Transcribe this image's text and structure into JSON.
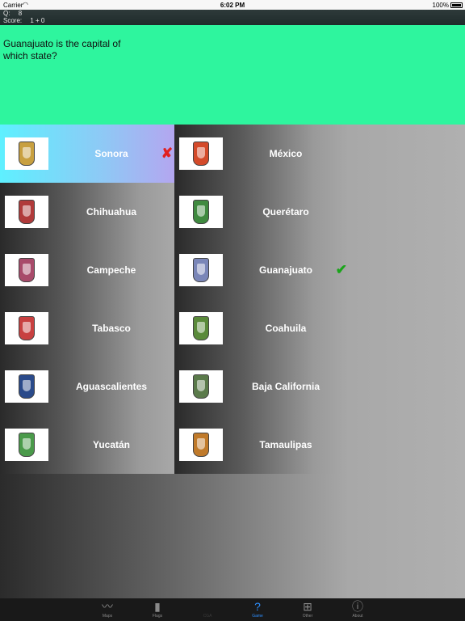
{
  "status_bar": {
    "carrier": "Carrier",
    "time": "6:02 PM",
    "battery": "100%"
  },
  "score": {
    "q_label": "Q:",
    "q_value": "8",
    "score_label": "Score:",
    "score_value": "1 + 0"
  },
  "question": {
    "text": "Guanajuato is the capital of which state?"
  },
  "answers": [
    {
      "name": "Sonora",
      "crest": "#c8a040",
      "state": "wrong"
    },
    {
      "name": "México",
      "crest": "#d44a2a"
    },
    {
      "name": "Chihuahua",
      "crest": "#b03a3a"
    },
    {
      "name": "Querétaro",
      "crest": "#3f8a3f"
    },
    {
      "name": "Campeche",
      "crest": "#a84a6a"
    },
    {
      "name": "Guanajuato",
      "crest": "#7a86b8",
      "state": "correct"
    },
    {
      "name": "Tabasco",
      "crest": "#c84040"
    },
    {
      "name": "Coahuila",
      "crest": "#5a8a3a"
    },
    {
      "name": "Aguascalientes",
      "crest": "#2a4a8a"
    },
    {
      "name": "Baja California",
      "crest": "#5a7a4a"
    },
    {
      "name": "Yucatán",
      "crest": "#4a9a4a"
    },
    {
      "name": "Tamaulipas",
      "crest": "#c07a2a"
    }
  ],
  "marks": {
    "wrong": "✘",
    "correct": "✔"
  },
  "tabs": [
    {
      "label": "Maps",
      "icon": "map-icon",
      "glyph": "〰"
    },
    {
      "label": "Flags",
      "icon": "flag-book-icon",
      "glyph": "▮"
    },
    {
      "label": "CGA",
      "icon": "cga-icon",
      "glyph": "",
      "state": "disabled"
    },
    {
      "label": "Game",
      "icon": "question-icon",
      "glyph": "?",
      "state": "active"
    },
    {
      "label": "Other",
      "icon": "grid-icon",
      "glyph": "⊞"
    },
    {
      "label": "About",
      "icon": "info-icon",
      "glyph": "ⓘ"
    }
  ]
}
